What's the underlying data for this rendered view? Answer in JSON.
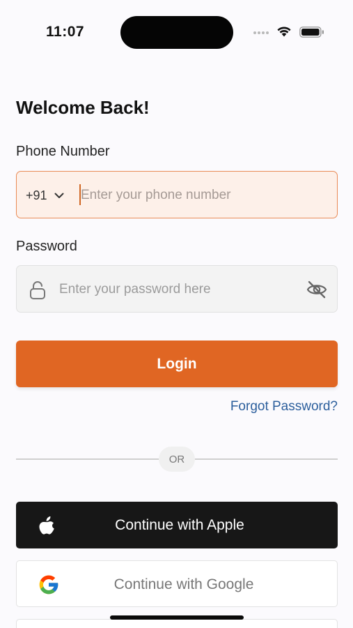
{
  "status_bar": {
    "time": "11:07",
    "icons": [
      "signal-dots-icon",
      "wifi-icon",
      "battery-icon"
    ]
  },
  "title": "Welcome Back!",
  "phone": {
    "label": "Phone Number",
    "country_code": "+91",
    "placeholder": "Enter your phone number",
    "value": ""
  },
  "password": {
    "label": "Password",
    "placeholder": "Enter your password here",
    "value": "",
    "icons": [
      "lock-icon",
      "eye-slash-icon"
    ]
  },
  "login_label": "Login",
  "forgot_label": "Forgot Password?",
  "divider_label": "OR",
  "apple_label": "Continue with Apple",
  "google_label": "Continue with Google",
  "colors": {
    "accent": "#e06623",
    "phone_field_bg": "#fdf0e9",
    "link": "#2b5e9c",
    "apple_button": "#171717"
  }
}
